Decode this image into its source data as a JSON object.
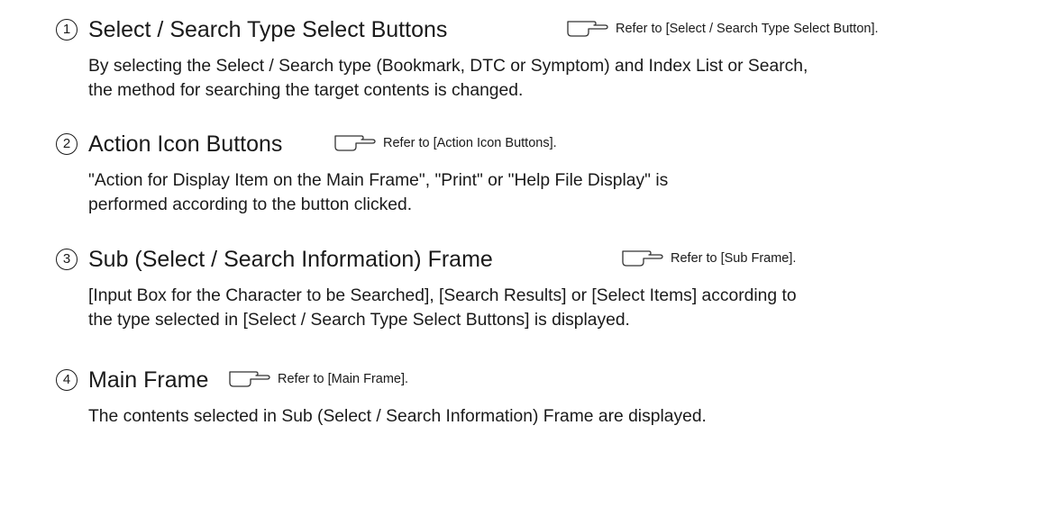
{
  "items": [
    {
      "number": "1",
      "title": "Select / Search Type Select Buttons",
      "refer": "Refer to [Select / Search Type Select Button].",
      "lines": [
        "By selecting the Select / Search type (Bookmark, DTC or Symptom) and Index List or Search,",
        "the method for searching the target contents is changed."
      ]
    },
    {
      "number": "2",
      "title": "Action Icon Buttons",
      "refer": "Refer to [Action Icon Buttons].",
      "lines": [
        "\"Action for Display Item on the Main Frame\", \"Print\" or \"Help File Display\" is",
        "performed according to the button clicked."
      ]
    },
    {
      "number": "3",
      "title": "Sub (Select / Search Information) Frame",
      "refer": "Refer to [Sub Frame].",
      "lines": [
        "[Input Box for the Character to be Searched], [Search Results] or [Select Items] according to",
        "the type selected in [Select / Search Type Select Buttons] is displayed."
      ]
    },
    {
      "number": "4",
      "title": "Main Frame",
      "refer": "Refer to [Main Frame].",
      "lines": [
        "The contents selected in Sub (Select / Search Information) Frame are displayed."
      ]
    }
  ],
  "icons": {
    "refer": "pointing-hand-icon"
  }
}
